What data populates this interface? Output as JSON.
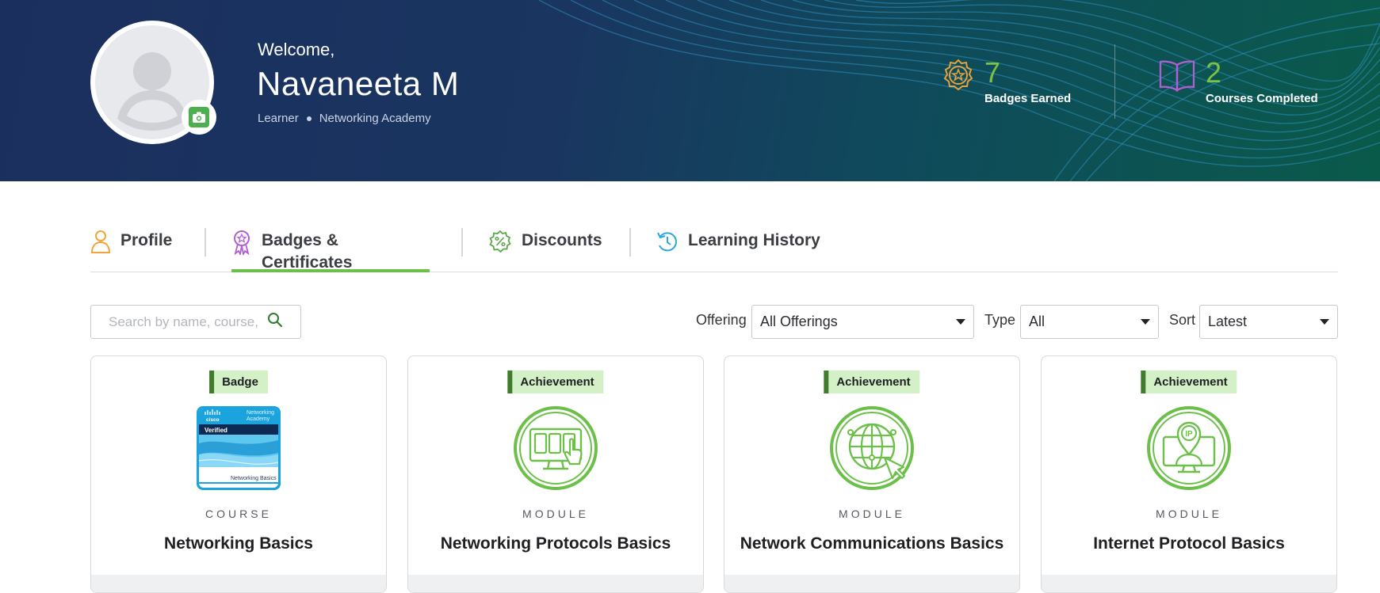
{
  "colors": {
    "accent_green": "#6cc04a",
    "stat_green": "#7dc242",
    "tag_bg": "#d4f0c7",
    "tag_border": "#3f7d2c",
    "hero_start": "#1b2f5e",
    "hero_end": "#0a5a4a"
  },
  "header": {
    "welcome": "Welcome,",
    "name": "Navaneeta M",
    "role": "Learner",
    "org": "Networking Academy",
    "avatar_icon": "user-avatar-icon",
    "camera_icon": "camera-icon"
  },
  "stats": [
    {
      "value": "7",
      "label": "Badges Earned",
      "icon": "badge-medal-icon"
    },
    {
      "value": "2",
      "label": "Courses Completed",
      "icon": "open-book-icon"
    }
  ],
  "tabs": [
    {
      "label": "Profile",
      "icon": "person-icon"
    },
    {
      "label": "Badges & Certificates",
      "icon": "ribbon-badge-icon",
      "active": true
    },
    {
      "label": "Discounts",
      "icon": "discount-percent-icon"
    },
    {
      "label": "Learning History",
      "icon": "history-clock-icon"
    }
  ],
  "filters": {
    "search_placeholder": "Search by name, course,",
    "offering_label": "Offering",
    "offering_value": "All Offerings",
    "type_label": "Type",
    "type_value": "All",
    "sort_label": "Sort",
    "sort_value": "Latest"
  },
  "cards": [
    {
      "tag": "Badge",
      "type": "COURSE",
      "title": "Networking Basics",
      "icon": "cisco-verified-badge-icon",
      "badge_brand": "cisco",
      "badge_program_1": "Networking",
      "badge_program_2": "Academy",
      "badge_verified": "Verified",
      "badge_course": "Networking Basics"
    },
    {
      "tag": "Achievement",
      "type": "MODULE",
      "title": "Networking Protocols Basics",
      "icon": "monitor-touch-icon"
    },
    {
      "tag": "Achievement",
      "type": "MODULE",
      "title": "Network Communications Basics",
      "icon": "globe-network-icon"
    },
    {
      "tag": "Achievement",
      "type": "MODULE",
      "title": "Internet Protocol Basics",
      "icon": "ip-location-monitor-icon",
      "icon_text": "IP"
    }
  ]
}
